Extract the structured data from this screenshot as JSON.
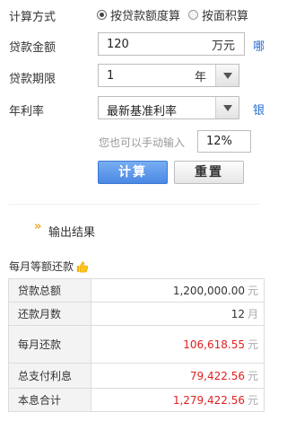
{
  "calc_method": {
    "label": "计算方式",
    "option_loan": "按贷款额度算",
    "option_area": "按面积算",
    "selected": "option_loan"
  },
  "loan_amount": {
    "label": "贷款金额",
    "value": "120",
    "unit": "万元",
    "side_text": "哪"
  },
  "loan_term": {
    "label": "贷款期限",
    "value": "1",
    "unit": "年"
  },
  "rate": {
    "label": "年利率",
    "selected": "最新基准利率",
    "side_text": "银"
  },
  "manual_rate": {
    "hint": "您也可以手动输入",
    "value": "12%"
  },
  "buttons": {
    "calc": "计算",
    "reset": "重置"
  },
  "output": {
    "heading": "输出结果",
    "section": "每月等额还款",
    "currency_unit": "元",
    "month_unit": "月",
    "rows": [
      {
        "label": "贷款总额",
        "value": "1,200,000.00",
        "unit": "元"
      },
      {
        "label": "还款月数",
        "value": "12",
        "unit": "月"
      },
      {
        "label": "每月还款",
        "value": "106,618.55",
        "unit": "元"
      },
      {
        "label": "总支付利息",
        "value": "79,422.56",
        "unit": "元"
      },
      {
        "label": "本息合计",
        "value": "1,279,422.56",
        "unit": "元"
      }
    ]
  },
  "colors": {
    "accent_blue": "#4a88e4",
    "result_red": "#e02020",
    "arrow_orange": "#f5a623"
  }
}
